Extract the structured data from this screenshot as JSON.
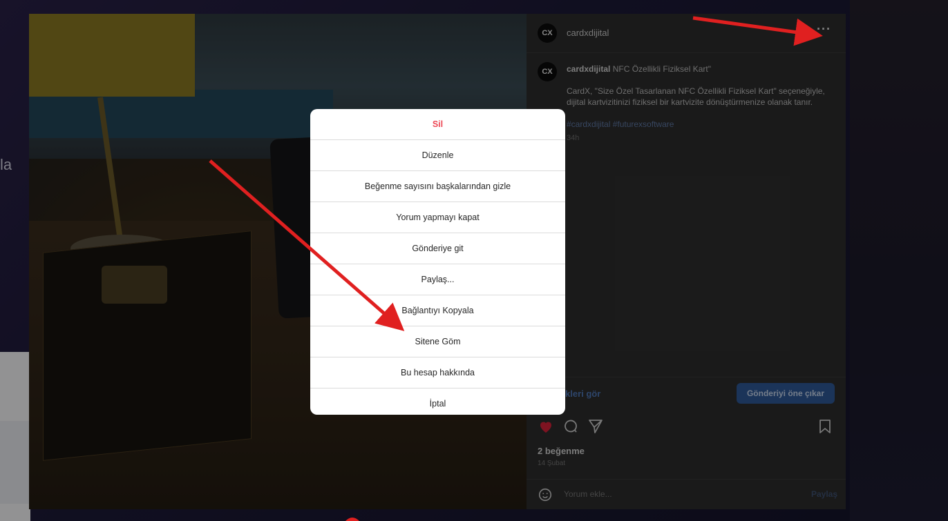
{
  "background": {
    "left_text_fragment": "la"
  },
  "post": {
    "account": {
      "avatar_text": "CX",
      "username": "cardxdijital"
    },
    "more_icon_glyph": "···",
    "caption": {
      "username": "cardxdijital",
      "first_line": "NFC Özellikli Fiziksel Kart\"",
      "body": "CardX, \"Size Özel Tasarlanan NFC Özellikli Fiziksel Kart\" seçeneğiyle, dijital kartvizitinizi fiziksel bir kartvizite dönüştürmenize olanak tanır.",
      "hashtags": "#cardxdijital #futurexsoftware",
      "ago": "34h"
    },
    "insights_link": "kleri gör",
    "promote_button": "Gönderiyi öne çıkar",
    "likes": "2 beğenme",
    "date": "14 Şubat",
    "comment_placeholder": "Yorum ekle...",
    "share_button": "Paylaş"
  },
  "dialog": {
    "options": [
      {
        "label": "Sil",
        "danger": true
      },
      {
        "label": "Düzenle"
      },
      {
        "label": "Beğenme sayısını başkalarından gizle"
      },
      {
        "label": "Yorum yapmayı kapat"
      },
      {
        "label": "Gönderiye git"
      },
      {
        "label": "Paylaş..."
      },
      {
        "label": "Bağlantıyı Kopyala"
      },
      {
        "label": "Sitene Göm"
      },
      {
        "label": "Bu hesap hakkında"
      },
      {
        "label": "İptal"
      }
    ]
  },
  "colors": {
    "danger": "#ed4956",
    "annotation_arrow": "#e02020",
    "heart": "#d9213a"
  },
  "icons": {
    "like": "heart-icon",
    "comment": "comment-icon",
    "share": "send-icon",
    "save": "bookmark-icon",
    "emoji": "emoji-icon"
  }
}
